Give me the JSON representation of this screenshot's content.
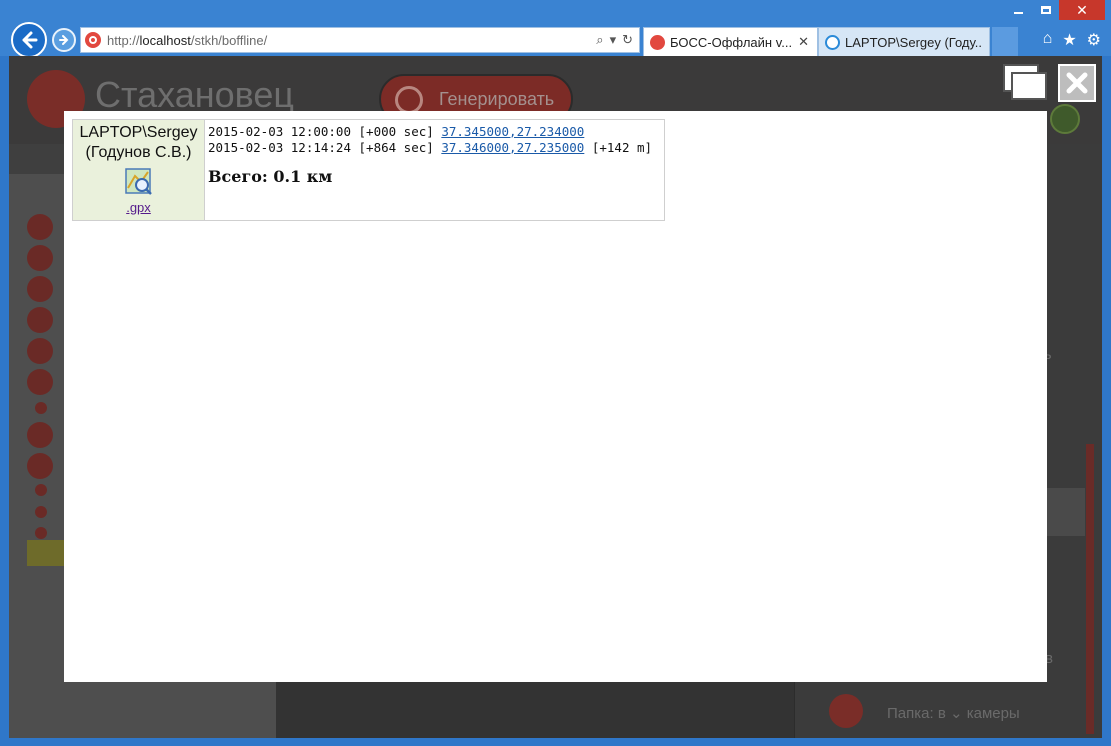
{
  "browser": {
    "url_prefix": "http://",
    "url_host": "localhost",
    "url_path": "/stkh/boffline/",
    "tabs": [
      {
        "label": "БОСС-Оффлайн v...",
        "active": true
      },
      {
        "label": "LAPTOP\\Sergey (Году...",
        "active": false
      }
    ]
  },
  "app": {
    "logo": "Стахановец",
    "generate_button": "Генерировать",
    "right_partial_1": "ль",
    "right_partial_2": "в",
    "folder_label": "Папка: в",
    "folder_suffix": "камеры"
  },
  "report": {
    "user_line1": "LAPTOP\\Sergey",
    "user_line2": "(Годунов С.В.)",
    "gpx_link": ".gpx",
    "rows": [
      {
        "time": "2015-02-03 12:00:00",
        "offset": "[+000 sec]",
        "coords": "37.345000,27.234000",
        "dist": ""
      },
      {
        "time": "2015-02-03 12:14:24",
        "offset": "[+864 sec]",
        "coords": "37.346000,27.235000",
        "dist": "[+142 m]"
      }
    ],
    "total": "Всего: 0.1 км"
  }
}
